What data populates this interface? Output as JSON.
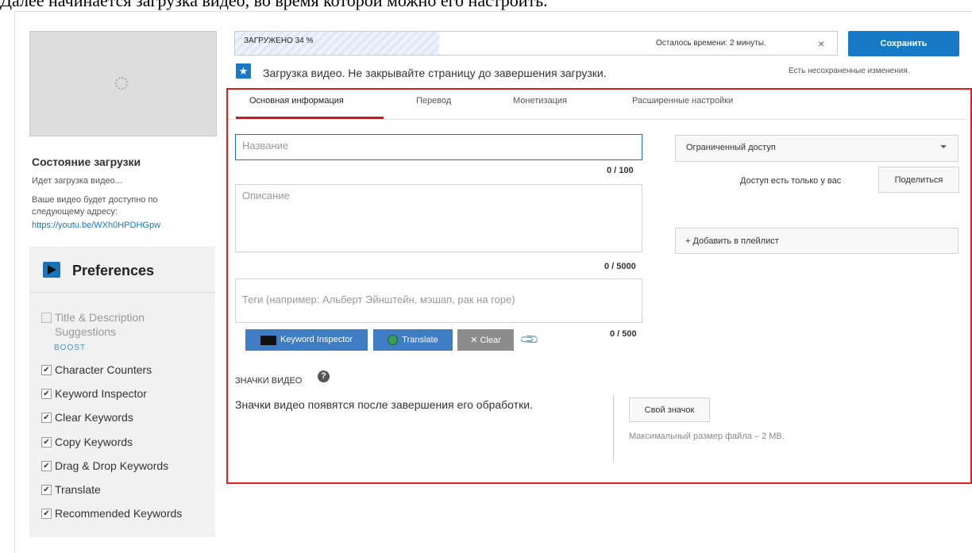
{
  "caption": "Далее начинается загрузка видео, во время которой можно его настроить.",
  "left": {
    "status_title": "Состояние загрузки",
    "status_line": "Идет загрузка видео...",
    "available_1": "Ваше видео будет доступно по",
    "available_2": "следующему адресу:",
    "video_url": "https://youtu.be/WXh0HPDHGpw"
  },
  "preferences": {
    "title": "Preferences",
    "suggestions_line1": "Title & Description",
    "suggestions_line2": "Suggestions",
    "boost": "BOOST",
    "items": [
      "Character Counters",
      "Keyword Inspector",
      "Clear Keywords",
      "Copy Keywords",
      "Drag & Drop Keywords",
      "Translate",
      "Recommended Keywords"
    ],
    "check_mark": "✔"
  },
  "top": {
    "progress_text": "ЗАГРУЖЕНО 34 %",
    "progress_fraction": 0.34,
    "time_left": "Осталось времени: 2 минуты.",
    "close": "×",
    "save": "Сохранить",
    "star": "★",
    "upload_msg": "Загрузка видео. Не закрывайте страницу до завершения загрузки.",
    "unsaved": "Есть несохраненные изменения."
  },
  "tabs": {
    "basic": "Основная информация",
    "translation": "Перевод",
    "monetization": "Монетизация",
    "advanced": "Расширенные настройки"
  },
  "form": {
    "title_placeholder": "Название",
    "title_counter": "0 / 100",
    "desc_placeholder": "Описание",
    "desc_counter": "0 / 5000",
    "tags_placeholder": "Теги (например: Альберт Эйнштейн, мэшап, рак на горе)",
    "tags_counter": "0 / 500"
  },
  "ext_buttons": {
    "keyword_inspector": "Keyword Inspector",
    "translate": "Translate",
    "clear": "✕ Clear",
    "clip": "📎"
  },
  "thumbnails": {
    "title": "ЗНАЧКИ ВИДЕО",
    "help": "?",
    "message": "Значки видео появятся после завершения его обработки.",
    "own_button": "Свой значок",
    "max_size": "Максимальный размер файла – 2 MB."
  },
  "right": {
    "access": "Ограниченный доступ",
    "only_you": "Доступ есть только у вас",
    "share": "Поделиться",
    "playlist": "+ Добавить в плейлист"
  },
  "colors": {
    "accent_blue": "#167ac6",
    "highlight_red": "#e21b1b"
  }
}
